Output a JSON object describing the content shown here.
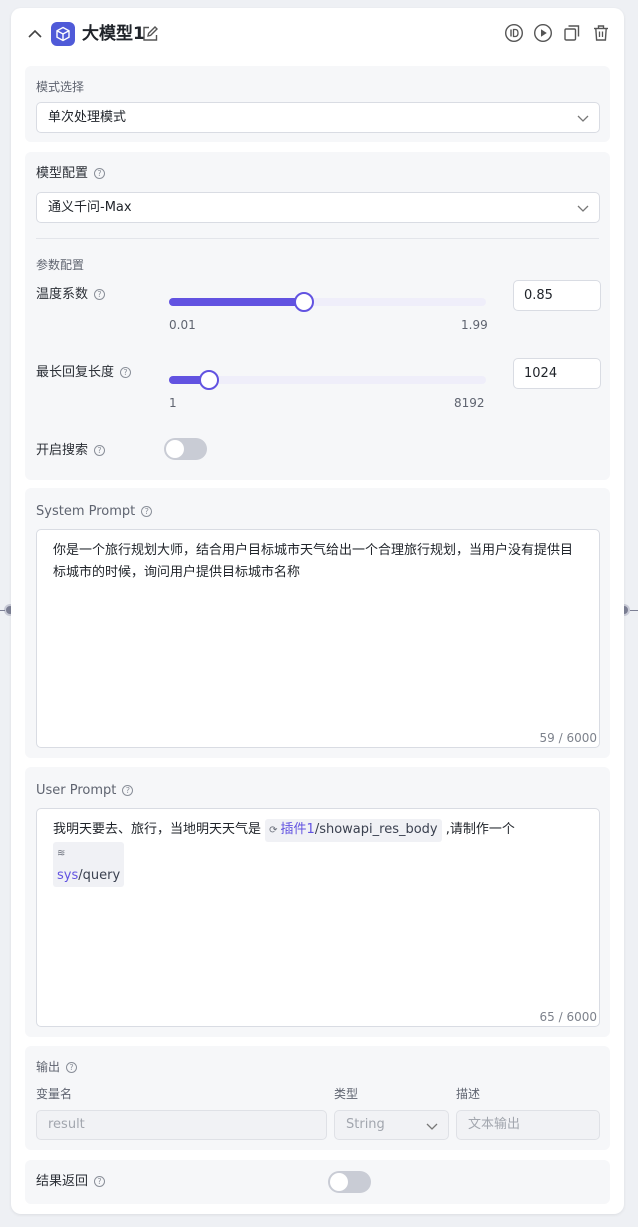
{
  "header": {
    "title": "大模型1",
    "icons": [
      "chevron-up-icon",
      "cube-logo-icon",
      "edit-icon",
      "id-icon",
      "play-icon",
      "copy-icon",
      "trash-icon"
    ]
  },
  "mode": {
    "label": "模式选择",
    "value": "单次处理模式"
  },
  "model_config": {
    "label": "模型配置",
    "model": "通义千问-Max",
    "params_label": "参数配置",
    "temperature": {
      "label": "温度系数",
      "min": "0.01",
      "max": "1.99",
      "value": "0.85",
      "fraction": 0.425
    },
    "max_length": {
      "label": "最长回复长度",
      "min": "1",
      "max": "8192",
      "value": "1024",
      "fraction": 0.125
    },
    "search": {
      "label": "开启搜索",
      "enabled": false
    }
  },
  "system_prompt": {
    "label": "System Prompt",
    "text": "你是一个旅行规划大师，结合用户目标城市天气给出一个合理旅行规划，当用户没有提供目标城市的时候，询问用户提供目标城市名称",
    "counter": "59 / 6000"
  },
  "user_prompt": {
    "label": "User Prompt",
    "text_before": "我明天要去、旅行，当地明天天气是",
    "var1_prefix": "插件1",
    "var1_path": "/showapi_res_body",
    "text_middle": ",请制作一个",
    "var2_prefix": "sys",
    "var2_path": "/query",
    "counter": "65 / 6000"
  },
  "output": {
    "label": "输出",
    "col_name": "变量名",
    "col_type": "类型",
    "col_desc": "描述",
    "name_value": "result",
    "type_value": "String",
    "desc_placeholder": "文本输出"
  },
  "result_return": {
    "label": "结果返回",
    "enabled": false
  },
  "colors": {
    "accent": "#6253e1",
    "logo": "#4f5ad8"
  }
}
